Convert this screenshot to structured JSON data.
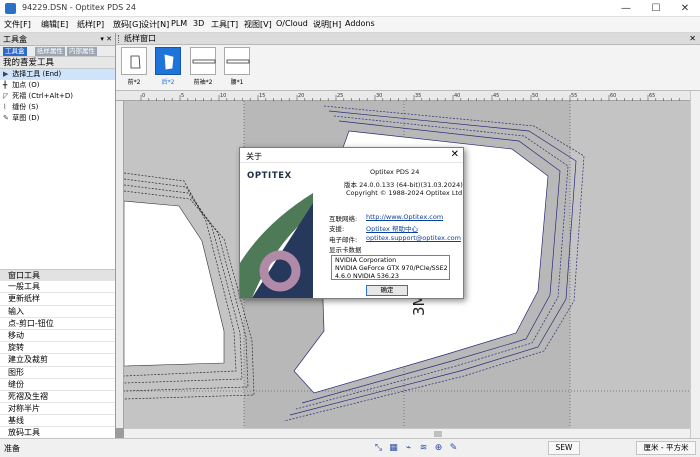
{
  "window": {
    "title": "94229.DSN - Optitex PDS 24",
    "controls": [
      "—",
      "☐",
      "✕"
    ]
  },
  "menu": [
    "文件[F]",
    "编辑[E]",
    "纸样[P]",
    "放码[G]",
    "设计[N]",
    "PLM",
    "3D",
    "工具[T]",
    "视图[V]",
    "O/Cloud",
    "说明[H]",
    "Addons"
  ],
  "toolbox": {
    "title": "工具盒",
    "tabs": [
      "工具盒",
      "纸样属性",
      "内部属性"
    ],
    "favorites_title": "我的喜爱工具",
    "favorites": [
      {
        "icon": "▶",
        "label": "选择工具 (End)"
      },
      {
        "icon": "╋",
        "label": "加点 (O)"
      },
      {
        "icon": "◸",
        "label": "死褶 (Ctrl+Alt+D)"
      },
      {
        "icon": "⌇",
        "label": "缝份 (S)"
      },
      {
        "icon": "✎",
        "label": "草图 (D)"
      }
    ],
    "groups": [
      "窗口工具",
      "一般工具",
      "更新纸样",
      "输入",
      "点-剪口-钮位",
      "移动",
      "旋转",
      "建立及裁剪",
      "图形",
      "缝份",
      "死褶及生褶",
      "对称半片",
      "基线",
      "放码工具"
    ]
  },
  "workspace": {
    "title": "纸样窗口",
    "pieces": [
      {
        "label": "前*2",
        "selected": false
      },
      {
        "label": "后*2",
        "selected": true
      },
      {
        "label": "前袖*2",
        "selected": false
      },
      {
        "label": "腰*1",
        "selected": false
      }
    ],
    "ruler_marks": [
      "0",
      "5",
      "10",
      "15",
      "20",
      "25",
      "30",
      "35",
      "40",
      "45",
      "50",
      "55",
      "60",
      "65"
    ],
    "piece_text": "3M_6M"
  },
  "about": {
    "title": "关于",
    "close": "✕",
    "logo": "OPTITEX",
    "product": "Optitex PDS 24",
    "version": "版本 24.0.0.133 (64-bit)(31.03.2024)",
    "copyright": "Copyright © 1988-2024 Optitex Ltd",
    "website_label": "互联网络:",
    "website": "http://www.Optitex.com",
    "support_label": "支援:",
    "support": "Optitex 帮助中心",
    "email_label": "电子邮件:",
    "email": "optitex.support@optitex.com",
    "gpu_label": "显示卡数据",
    "gpu": [
      "NVIDIA Corporation",
      "NVIDIA GeForce GTX 970/PCIe/SSE2",
      "4.6.0 NVIDIA 536.23"
    ],
    "ok": "确定"
  },
  "status": {
    "text": "准备",
    "mode": "SEW",
    "unit": "厘米 - 平方米"
  },
  "colors": {
    "accent": "#1f74d9",
    "logo_green": "#4f7a58",
    "logo_navy": "#26395c",
    "logo_mauve": "#b08aa7",
    "pattern_line": "#2a2a7a"
  }
}
